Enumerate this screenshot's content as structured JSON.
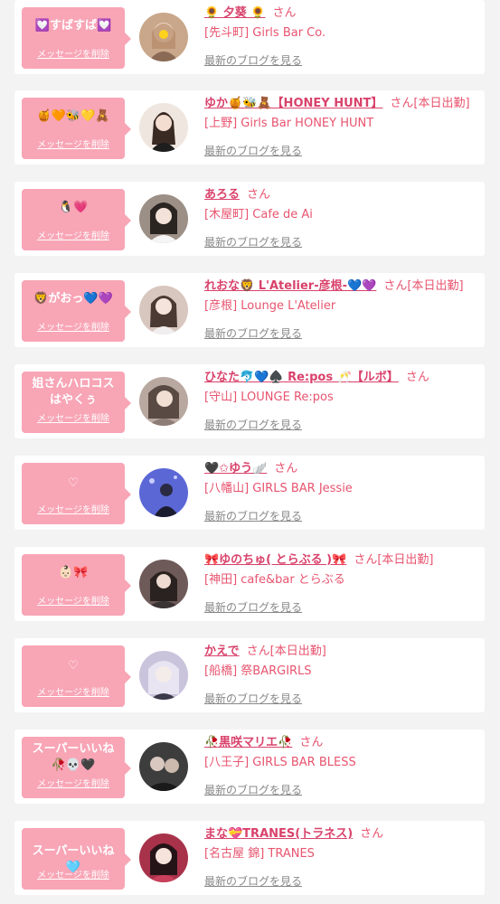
{
  "delete_label": "メッセージを削除",
  "blog_label": "最新のブログを見る",
  "san_label": "さん",
  "items": [
    {
      "message": "💟すばすば💟",
      "name": "🌻 夕葵 🌻",
      "tag": "",
      "shop": "[先斗町] Girls Bar Co.",
      "avatar_color": "#c9a78a"
    },
    {
      "message": "🍯🧡🐝💛🧸",
      "name": "ゆか🍯🐝🧸【HONEY HUNT】",
      "tag": "[本日出勤]",
      "shop": "[上野] Girls Bar HONEY HUNT",
      "avatar_color": "#e9dcd2"
    },
    {
      "message": "🐧💗",
      "name": "あろる",
      "tag": "",
      "shop": "[木屋町] Cafe de Ai",
      "avatar_color": "#9c8f86"
    },
    {
      "message": "🦁がおっ💙💜",
      "name": "れおな🦁 L'Atelier-彦根-💙💜",
      "tag": "[本日出勤]",
      "shop": "[彦根] Lounge L'Atelier",
      "avatar_color": "#d8c7bf"
    },
    {
      "message": "姐さんハロコスはやくぅ",
      "name": "ひなた🐬💙♠️ Re:pos 🥂【ルボ】",
      "tag": "",
      "shop": "[守山] LOUNGE Re:pos",
      "avatar_color": "#b9a8a0"
    },
    {
      "message": "♡",
      "name": "🖤✩ゆう🪽",
      "tag": "",
      "shop": "[八幡山] GIRLS BAR Jessie",
      "avatar_color": "#5c67d6"
    },
    {
      "message": "👶🏻🎀",
      "name": "🎀ゆのちゅ( とらぶる )🎀",
      "tag": "[本日出勤]",
      "shop": "[神田] cafe&bar とらぶる",
      "avatar_color": "#6e5a58"
    },
    {
      "message": "♡",
      "name": "かえで",
      "tag": "[本日出勤]",
      "shop": "[船橋] 祭BARGIRLS",
      "avatar_color": "#c9c3dc"
    },
    {
      "message": "スーパーいいね🥀💀🖤",
      "name": "🥀黒咲マリエ🥀",
      "tag": "",
      "shop": "[八王子] GIRLS BAR BLESS",
      "avatar_color": "#3d3d3d"
    },
    {
      "message": "スーパーいいね🩵",
      "name": "まな💝TRANES(トラネス)",
      "tag": "",
      "shop": "[名古屋 錦] TRANES",
      "avatar_color": "#a8324a"
    }
  ]
}
